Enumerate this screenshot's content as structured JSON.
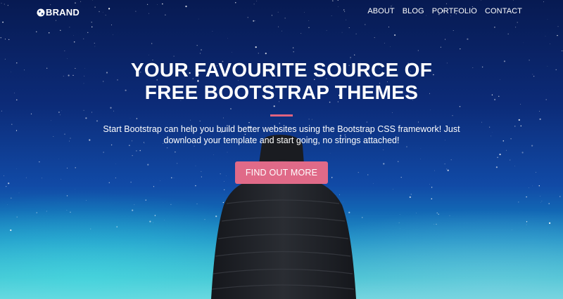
{
  "nav": {
    "brand_label": "BRAND",
    "brand_icon": "globe-icon",
    "links": [
      "ABOUT",
      "BLOG",
      "PORTFOLIO",
      "CONTACT"
    ]
  },
  "hero": {
    "title_line1": "YOUR FAVOURITE SOURCE OF",
    "title_line2": "FREE BOOTSTRAP THEMES",
    "lead_line1": "Start Bootstrap can help you build better websites using the Bootstrap CSS framework! Just",
    "lead_line2": "download your template and start going, no strings attached!",
    "cta_label": "FIND OUT MORE"
  },
  "colors": {
    "accent": "#e06a88",
    "divider": "#e0637f",
    "sky_top": "#071a52",
    "horizon": "#2bb6cf"
  }
}
